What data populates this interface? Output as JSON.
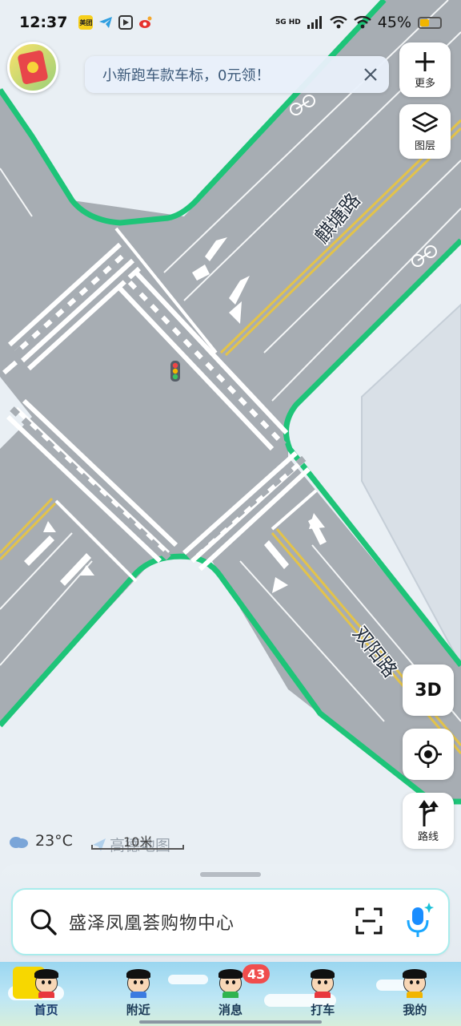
{
  "status_bar": {
    "time": "12:37",
    "network": "5G HD",
    "battery": "45%",
    "battery_level": 0.45,
    "app_icons": [
      "meituan-icon",
      "telegram-icon",
      "video-icon",
      "weibo-icon"
    ],
    "app_icon_text": {
      "meituan": "美团"
    }
  },
  "notice": {
    "text": "小新跑车款车标，0元领！"
  },
  "controls": {
    "more_label": "更多",
    "layers_label": "图层",
    "three_d_label": "3D",
    "route_label": "路线"
  },
  "map": {
    "roads": [
      "麒塘路",
      "双阳路"
    ],
    "colors": {
      "land": "#e9eff4",
      "road": "#a7adb3",
      "boundary": "#1ec478",
      "center_line": "#e3c34a",
      "building": "#d8dee5"
    },
    "icons": [
      "traffic-light-icon",
      "bike-lane-icon"
    ]
  },
  "overlay": {
    "temperature": "23°C",
    "scale_label": "10米",
    "watermark": "高德地图"
  },
  "search": {
    "placeholder": "盛泽凤凰荟购物中心"
  },
  "tabs": [
    {
      "label": "首页",
      "active": true
    },
    {
      "label": "附近"
    },
    {
      "label": "消息",
      "badge": "43"
    },
    {
      "label": "打车"
    },
    {
      "label": "我的"
    }
  ]
}
